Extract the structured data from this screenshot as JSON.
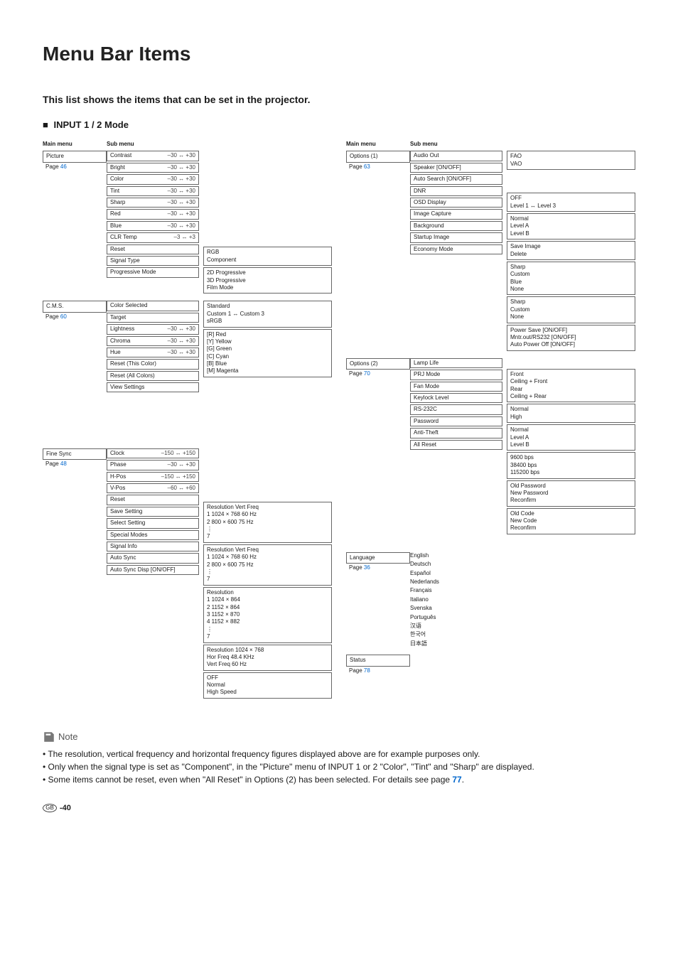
{
  "title": "Menu Bar Items",
  "intro": "This list shows the items that can be set in the projector.",
  "mode": "INPUT 1 / 2 Mode",
  "headers": {
    "main": "Main menu",
    "sub": "Sub menu"
  },
  "left": [
    {
      "main": "Picture",
      "page": "46",
      "subs": [
        {
          "label": "Contrast",
          "range": "–30 ↔ +30"
        },
        {
          "label": "Bright",
          "range": "–30 ↔ +30"
        },
        {
          "label": "Color",
          "range": "–30 ↔ +30"
        },
        {
          "label": "Tint",
          "range": "–30 ↔ +30"
        },
        {
          "label": "Sharp",
          "range": "–30 ↔ +30"
        },
        {
          "label": "Red",
          "range": "–30 ↔ +30"
        },
        {
          "label": "Blue",
          "range": "–30 ↔ +30"
        },
        {
          "label": "CLR Temp",
          "range": "–3 ↔ +3"
        },
        {
          "label": "Reset"
        },
        {
          "label": "Signal Type",
          "opts": [
            "RGB",
            "Component"
          ]
        },
        {
          "label": "Progressive Mode",
          "opts": [
            "2D Progressive",
            "3D Progressive",
            "Film Mode"
          ]
        }
      ]
    },
    {
      "main": "C.M.S.",
      "page": "60",
      "subs": [
        {
          "label": "Color Selected",
          "opts": [
            "Standard",
            "Custom 1 ↔ Custom 3",
            "sRGB"
          ]
        },
        {
          "label": "Target",
          "opts": [
            "[R] Red",
            "[Y] Yellow",
            "[G] Green",
            "[C] Cyan",
            "[B] Blue",
            "[M] Magenta"
          ]
        },
        {
          "label": "Lightness",
          "range": "–30 ↔ +30"
        },
        {
          "label": "Chroma",
          "range": "–30 ↔ +30"
        },
        {
          "label": "Hue",
          "range": "–30 ↔ +30"
        },
        {
          "label": "Reset (This Color)"
        },
        {
          "label": "Reset (All Colors)"
        },
        {
          "label": "View Settings"
        }
      ]
    },
    {
      "main": "Fine Sync",
      "page": "48",
      "subs": [
        {
          "label": "Clock",
          "range": "–150 ↔ +150"
        },
        {
          "label": "Phase",
          "range": "–30 ↔ +30"
        },
        {
          "label": "H-Pos",
          "range": "–150 ↔ +150"
        },
        {
          "label": "V-Pos",
          "range": "–60 ↔ +60"
        },
        {
          "label": "Reset"
        },
        {
          "label": "Save Setting",
          "opts": [
            "   Resolution  Vert Freq",
            "1  1024 × 768   60 Hz",
            "2   800 × 600    75 Hz",
            "⋮",
            "7"
          ]
        },
        {
          "label": "Select Setting",
          "opts": [
            "   Resolution  Vert Freq",
            "1  1024 × 768   60 Hz",
            "2   800 × 600    75 Hz",
            "⋮",
            "7"
          ]
        },
        {
          "label": "Special Modes",
          "opts": [
            "    Resolution",
            "1  1024 × 864",
            "2  1152 × 864",
            "3  1152 × 870",
            "4  1152 × 882",
            "⋮",
            "7"
          ]
        },
        {
          "label": "Signal Info",
          "opts": [
            "Resolution    1024 × 768",
            "Hor Freq      48.4 KHz",
            "Vert Freq     60 Hz"
          ]
        },
        {
          "label": "Auto Sync",
          "opts": [
            "OFF",
            "Normal",
            "High Speed"
          ]
        },
        {
          "label": "Auto Sync Disp [ON/OFF]"
        }
      ]
    }
  ],
  "right": [
    {
      "main": "Options (1)",
      "page": "63",
      "subs": [
        {
          "label": "Audio Out",
          "opts": [
            "FAO",
            "VAO"
          ]
        },
        {
          "label": "Speaker [ON/OFF]"
        },
        {
          "label": "Auto Search [ON/OFF]"
        },
        {
          "label": "DNR",
          "opts": [
            "OFF",
            "Level 1 ↔ Level 3"
          ]
        },
        {
          "label": "OSD Display",
          "opts": [
            "Normal",
            "Level A",
            "Level B"
          ]
        },
        {
          "label": "Image Capture",
          "opts": [
            "Save Image",
            "Delete"
          ]
        },
        {
          "label": "Background",
          "opts": [
            "Sharp",
            "Custom",
            "Blue",
            "None"
          ]
        },
        {
          "label": "Startup Image",
          "opts": [
            "Sharp",
            "Custom",
            "None"
          ]
        },
        {
          "label": "Economy Mode",
          "opts": [
            "Power Save [ON/OFF]",
            "Mntr.out/RS232 [ON/OFF]",
            "Auto Power Off [ON/OFF]"
          ]
        }
      ]
    },
    {
      "main": "Options (2)",
      "page": "70",
      "subs": [
        {
          "label": "Lamp Life"
        },
        {
          "label": "PRJ Mode",
          "opts": [
            "Front",
            "Ceiling + Front",
            "Rear",
            "Ceiling + Rear"
          ]
        },
        {
          "label": "Fan Mode",
          "opts": [
            "Normal",
            "High"
          ]
        },
        {
          "label": "Keylock Level",
          "opts": [
            "Normal",
            "Level A",
            "Level B"
          ]
        },
        {
          "label": "RS-232C",
          "opts": [
            "9600 bps",
            "38400 bps",
            "115200 bps"
          ]
        },
        {
          "label": "Password",
          "opts": [
            "Old Password",
            "New Password",
            "Reconfirm"
          ]
        },
        {
          "label": "Anti-Theft",
          "opts": [
            "Old Code",
            "New Code",
            "Reconfirm"
          ]
        },
        {
          "label": "All Reset"
        }
      ]
    },
    {
      "main": "Language",
      "page": "36",
      "plain": [
        "English",
        "Deutsch",
        "Español",
        "Nederlands",
        "Français",
        "Italiano",
        "Svenska",
        "Português",
        "汉语",
        "한국어",
        "日本語"
      ]
    },
    {
      "main": "Status",
      "page": "78"
    }
  ],
  "notes": [
    "The resolution, vertical frequency and horizontal frequency figures displayed above are for example purposes only.",
    "Only when the signal type is set as \"Component\", in the \"Picture\" menu of INPUT 1 or 2 \"Color\", \"Tint\" and \"Sharp\" are displayed.",
    "Some items cannot be reset, even when \"All Reset\" in Options (2) has been selected. For details see page "
  ],
  "note_link": "77",
  "footer_gb": "GB",
  "footer_page": "-40"
}
